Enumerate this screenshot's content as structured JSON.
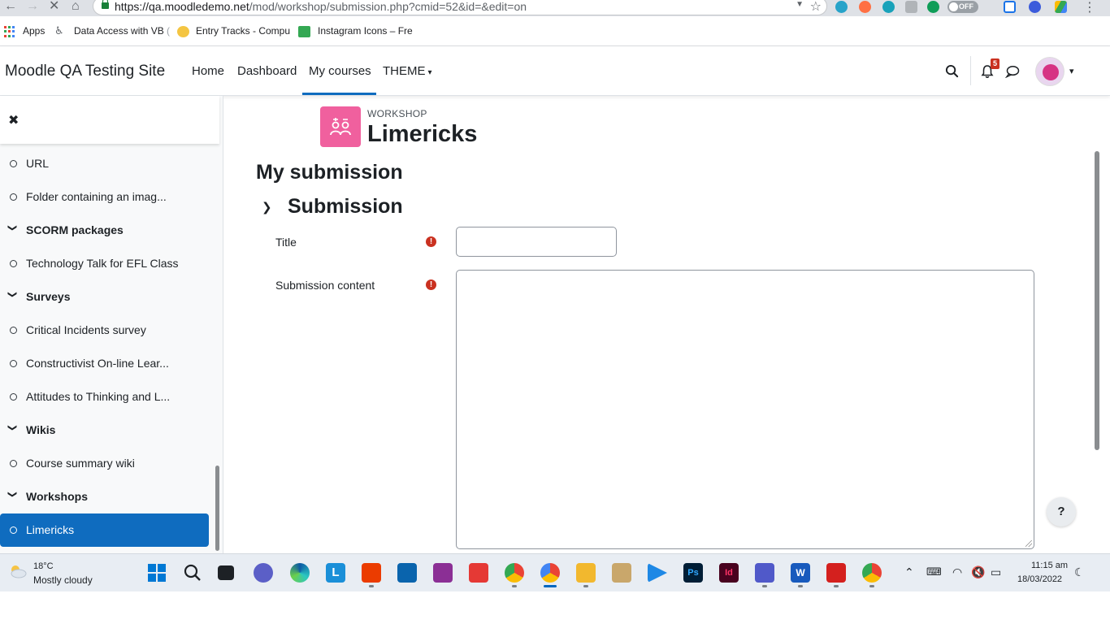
{
  "browser": {
    "url_host": "https://qa.moodledemo.net",
    "url_path": "/mod/workshop/submission.php?cmid=52&id=&edit=on",
    "toggle_label": "OFF",
    "bookmarks": [
      {
        "label": "Apps"
      },
      {
        "label": "Data Access with VB",
        "fade": " ("
      },
      {
        "label": "Entry Tracks - Compu",
        "fade": ""
      },
      {
        "label": "Instagram Icons – Fre",
        "fade": ""
      }
    ]
  },
  "navbar": {
    "site_name": "Moodle QA Testing Site",
    "links": [
      "Home",
      "Dashboard",
      "My courses",
      "THEME"
    ],
    "notification_count": "5"
  },
  "drawer": {
    "items": [
      {
        "type": "item",
        "label": "URL"
      },
      {
        "type": "item",
        "label": "Folder containing an imag..."
      },
      {
        "type": "section",
        "label": "SCORM packages"
      },
      {
        "type": "item",
        "label": "Technology Talk for EFL Class"
      },
      {
        "type": "section",
        "label": "Surveys"
      },
      {
        "type": "item",
        "label": "Critical Incidents survey"
      },
      {
        "type": "item",
        "label": "Constructivist On-line Lear..."
      },
      {
        "type": "item",
        "label": "Attitudes to Thinking and L..."
      },
      {
        "type": "section",
        "label": "Wikis"
      },
      {
        "type": "item",
        "label": "Course summary wiki"
      },
      {
        "type": "section",
        "label": "Workshops"
      },
      {
        "type": "item",
        "label": "Limericks",
        "active": true
      }
    ]
  },
  "main": {
    "pre_title": "WORKSHOP",
    "title": "Limericks",
    "heading": "My submission",
    "section": "Submission",
    "fields": {
      "title_label": "Title",
      "content_label": "Submission content",
      "title_value": "",
      "content_value": ""
    },
    "help_label": "?"
  },
  "taskbar": {
    "temperature": "18°C",
    "condition": "Mostly cloudy",
    "time": "11:15 am",
    "date": "18/03/2022"
  },
  "colors": {
    "brand": "#0f6cbf",
    "workshop_icon": "#f0609e",
    "required": "#ca3120"
  }
}
